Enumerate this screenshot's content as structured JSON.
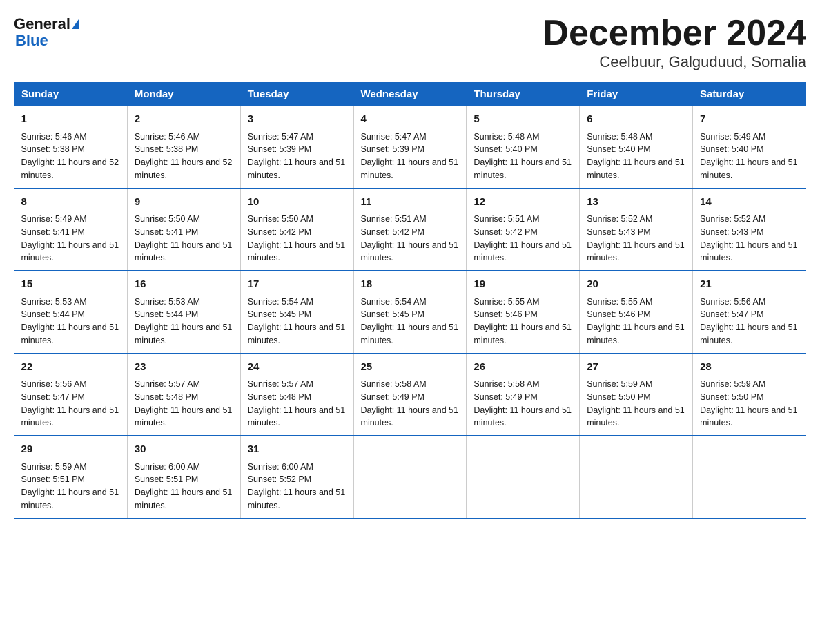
{
  "header": {
    "logo_line1": "General",
    "logo_line2": "Blue",
    "title": "December 2024",
    "subtitle": "Ceelbuur, Galguduud, Somalia"
  },
  "days_of_week": [
    "Sunday",
    "Monday",
    "Tuesday",
    "Wednesday",
    "Thursday",
    "Friday",
    "Saturday"
  ],
  "weeks": [
    [
      {
        "day": "1",
        "sunrise": "5:46 AM",
        "sunset": "5:38 PM",
        "daylight": "11 hours and 52 minutes."
      },
      {
        "day": "2",
        "sunrise": "5:46 AM",
        "sunset": "5:38 PM",
        "daylight": "11 hours and 52 minutes."
      },
      {
        "day": "3",
        "sunrise": "5:47 AM",
        "sunset": "5:39 PM",
        "daylight": "11 hours and 51 minutes."
      },
      {
        "day": "4",
        "sunrise": "5:47 AM",
        "sunset": "5:39 PM",
        "daylight": "11 hours and 51 minutes."
      },
      {
        "day": "5",
        "sunrise": "5:48 AM",
        "sunset": "5:40 PM",
        "daylight": "11 hours and 51 minutes."
      },
      {
        "day": "6",
        "sunrise": "5:48 AM",
        "sunset": "5:40 PM",
        "daylight": "11 hours and 51 minutes."
      },
      {
        "day": "7",
        "sunrise": "5:49 AM",
        "sunset": "5:40 PM",
        "daylight": "11 hours and 51 minutes."
      }
    ],
    [
      {
        "day": "8",
        "sunrise": "5:49 AM",
        "sunset": "5:41 PM",
        "daylight": "11 hours and 51 minutes."
      },
      {
        "day": "9",
        "sunrise": "5:50 AM",
        "sunset": "5:41 PM",
        "daylight": "11 hours and 51 minutes."
      },
      {
        "day": "10",
        "sunrise": "5:50 AM",
        "sunset": "5:42 PM",
        "daylight": "11 hours and 51 minutes."
      },
      {
        "day": "11",
        "sunrise": "5:51 AM",
        "sunset": "5:42 PM",
        "daylight": "11 hours and 51 minutes."
      },
      {
        "day": "12",
        "sunrise": "5:51 AM",
        "sunset": "5:42 PM",
        "daylight": "11 hours and 51 minutes."
      },
      {
        "day": "13",
        "sunrise": "5:52 AM",
        "sunset": "5:43 PM",
        "daylight": "11 hours and 51 minutes."
      },
      {
        "day": "14",
        "sunrise": "5:52 AM",
        "sunset": "5:43 PM",
        "daylight": "11 hours and 51 minutes."
      }
    ],
    [
      {
        "day": "15",
        "sunrise": "5:53 AM",
        "sunset": "5:44 PM",
        "daylight": "11 hours and 51 minutes."
      },
      {
        "day": "16",
        "sunrise": "5:53 AM",
        "sunset": "5:44 PM",
        "daylight": "11 hours and 51 minutes."
      },
      {
        "day": "17",
        "sunrise": "5:54 AM",
        "sunset": "5:45 PM",
        "daylight": "11 hours and 51 minutes."
      },
      {
        "day": "18",
        "sunrise": "5:54 AM",
        "sunset": "5:45 PM",
        "daylight": "11 hours and 51 minutes."
      },
      {
        "day": "19",
        "sunrise": "5:55 AM",
        "sunset": "5:46 PM",
        "daylight": "11 hours and 51 minutes."
      },
      {
        "day": "20",
        "sunrise": "5:55 AM",
        "sunset": "5:46 PM",
        "daylight": "11 hours and 51 minutes."
      },
      {
        "day": "21",
        "sunrise": "5:56 AM",
        "sunset": "5:47 PM",
        "daylight": "11 hours and 51 minutes."
      }
    ],
    [
      {
        "day": "22",
        "sunrise": "5:56 AM",
        "sunset": "5:47 PM",
        "daylight": "11 hours and 51 minutes."
      },
      {
        "day": "23",
        "sunrise": "5:57 AM",
        "sunset": "5:48 PM",
        "daylight": "11 hours and 51 minutes."
      },
      {
        "day": "24",
        "sunrise": "5:57 AM",
        "sunset": "5:48 PM",
        "daylight": "11 hours and 51 minutes."
      },
      {
        "day": "25",
        "sunrise": "5:58 AM",
        "sunset": "5:49 PM",
        "daylight": "11 hours and 51 minutes."
      },
      {
        "day": "26",
        "sunrise": "5:58 AM",
        "sunset": "5:49 PM",
        "daylight": "11 hours and 51 minutes."
      },
      {
        "day": "27",
        "sunrise": "5:59 AM",
        "sunset": "5:50 PM",
        "daylight": "11 hours and 51 minutes."
      },
      {
        "day": "28",
        "sunrise": "5:59 AM",
        "sunset": "5:50 PM",
        "daylight": "11 hours and 51 minutes."
      }
    ],
    [
      {
        "day": "29",
        "sunrise": "5:59 AM",
        "sunset": "5:51 PM",
        "daylight": "11 hours and 51 minutes."
      },
      {
        "day": "30",
        "sunrise": "6:00 AM",
        "sunset": "5:51 PM",
        "daylight": "11 hours and 51 minutes."
      },
      {
        "day": "31",
        "sunrise": "6:00 AM",
        "sunset": "5:52 PM",
        "daylight": "11 hours and 51 minutes."
      },
      null,
      null,
      null,
      null
    ]
  ],
  "labels": {
    "sunrise": "Sunrise:",
    "sunset": "Sunset:",
    "daylight": "Daylight:"
  }
}
